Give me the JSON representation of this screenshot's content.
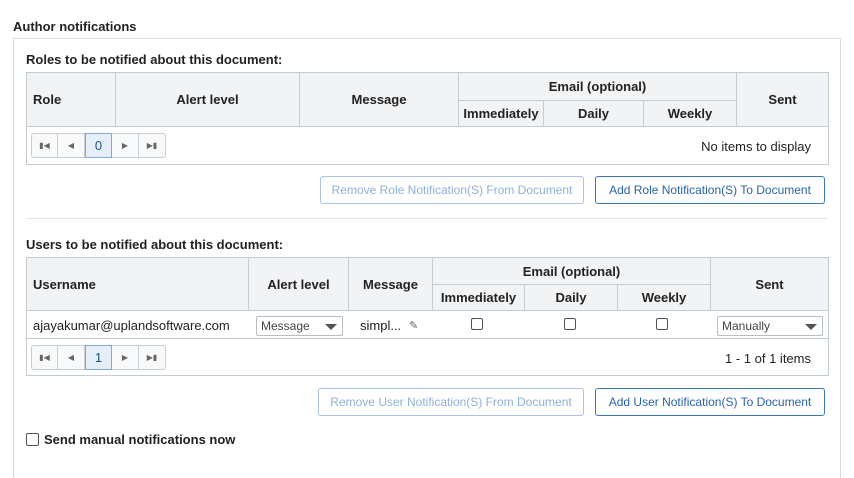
{
  "section_title": "Author notifications",
  "roles": {
    "title": "Roles to be notified about this document:",
    "headers": {
      "role": "Role",
      "alert_level": "Alert level",
      "message": "Message",
      "email": "Email (optional)",
      "immediately": "Immediately",
      "daily": "Daily",
      "weekly": "Weekly",
      "sent": "Sent"
    },
    "pager": {
      "page": "0",
      "info": "No items to display"
    },
    "remove_button": "Remove Role Notification(S) From Document",
    "add_button": "Add Role Notification(S) To Document"
  },
  "users": {
    "title": "Users to be notified about this document:",
    "headers": {
      "username": "Username",
      "alert_level": "Alert level",
      "message": "Message",
      "email": "Email (optional)",
      "immediately": "Immediately",
      "daily": "Daily",
      "weekly": "Weekly",
      "sent": "Sent"
    },
    "rows": [
      {
        "username": "ajayakumar@uplandsoftware.com",
        "alert_level": "Message",
        "message": "simpl...",
        "immediately": false,
        "daily": false,
        "weekly": false,
        "sent": "Manually"
      }
    ],
    "pager": {
      "page": "1",
      "info": "1 - 1 of 1 items"
    },
    "remove_button": "Remove User Notification(S) From Document",
    "add_button": "Add User Notification(S) To Document"
  },
  "manual_notifications": {
    "label": "Send manual notifications now",
    "checked": false
  },
  "icons": {
    "first": "first-page-icon",
    "prev": "prev-page-icon",
    "next": "next-page-icon",
    "last": "last-page-icon",
    "edit": "pencil-icon",
    "dropdown": "chevron-down-icon"
  }
}
